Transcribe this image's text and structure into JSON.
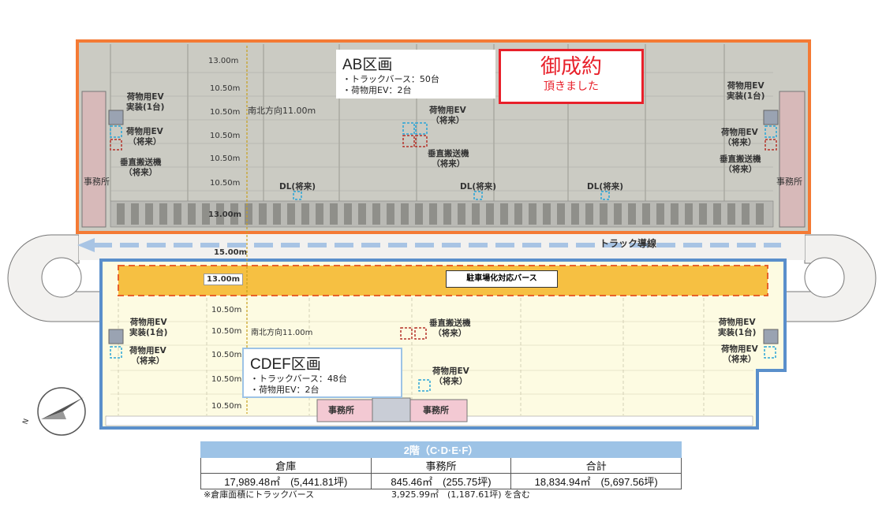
{
  "colors": {
    "ab_border": "#f47a34",
    "cdef_border": "#5a8fcb",
    "ab_fill": "#cbcbc3",
    "cdef_fill": "#fdfbe2",
    "parking_band": "#f6c042",
    "seiyaku_red": "#e8202a",
    "truck_arrow": "#a8c4e4",
    "table_header": "#9dc3e6"
  },
  "ab": {
    "title": "AB区画",
    "rows": [
      "・トラックバース：50台",
      "・荷物用EV：2台"
    ],
    "dims": [
      "13.00m",
      "10.50m",
      "10.50m",
      "10.50m",
      "10.50m",
      "10.50m",
      "13.00m"
    ],
    "direction": "南北方向11.00m",
    "left_ev_line1": "荷物用EV",
    "left_ev_line2": "実装(1台)",
    "left_ev_future_line1": "荷物用EV",
    "left_ev_future_line2": "（将来）",
    "left_lift_line1": "垂直搬送機",
    "left_lift_line2": "（将来）",
    "center_ev_line1": "荷物用EV",
    "center_ev_line2": "（将来）",
    "center_lift_line1": "垂直搬送機",
    "center_lift_line2": "（将来）",
    "right_ev_line1": "荷物用EV",
    "right_ev_line2": "実装(1台)",
    "right_ev_future_line1": "荷物用EV",
    "right_ev_future_line2": "（将来）",
    "right_lift_line1": "垂直搬送機",
    "right_lift_line2": "（将来）",
    "dl1": "DL(将来)",
    "dl2": "DL(将来)",
    "dl3": "DL(将来)",
    "office_left": "事務所",
    "office_right": "事務所"
  },
  "seiyaku": {
    "line1": "御成約",
    "line2": "頂きました"
  },
  "truck_route": "トラック導線",
  "gap_dim": "15.00m",
  "cdef": {
    "title": "CDEF区画",
    "rows": [
      "・トラックバース：48台",
      "・荷物用EV：2台"
    ],
    "band_dim": "13.00m",
    "parking_label": "駐車場化対応バース",
    "dims": [
      "10.50m",
      "10.50m",
      "10.50m",
      "10.50m",
      "10.50m"
    ],
    "direction": "南北方向11.00m",
    "left_ev_line1": "荷物用EV",
    "left_ev_line2": "実装(1台)",
    "left_ev_future_line1": "荷物用EV",
    "left_ev_future_line2": "（将来）",
    "center_lift_line1": "垂直搬送機",
    "center_lift_line2": "（将来）",
    "center_ev_line1": "荷物用EV",
    "center_ev_line2": "（将来）",
    "right_ev_line1": "荷物用EV",
    "right_ev_line2": "実装(1台)",
    "right_ev_future_line1": "荷物用EV",
    "right_ev_future_line2": "（将来）",
    "office1": "事務所",
    "office2": "事務所"
  },
  "compass": "N",
  "table": {
    "title": "2階（C·D·E·F）",
    "headers": [
      "倉庫",
      "事務所",
      "合計"
    ],
    "values": [
      "17,989.48㎡　(5,441.81坪)",
      "845.46㎡　(255.75坪)",
      "18,834.94㎡　(5,697.56坪)"
    ]
  },
  "footnote": "※倉庫面積にトラックバース",
  "footnote_value": "3,925.99㎡　(1,187.61坪) を含む"
}
